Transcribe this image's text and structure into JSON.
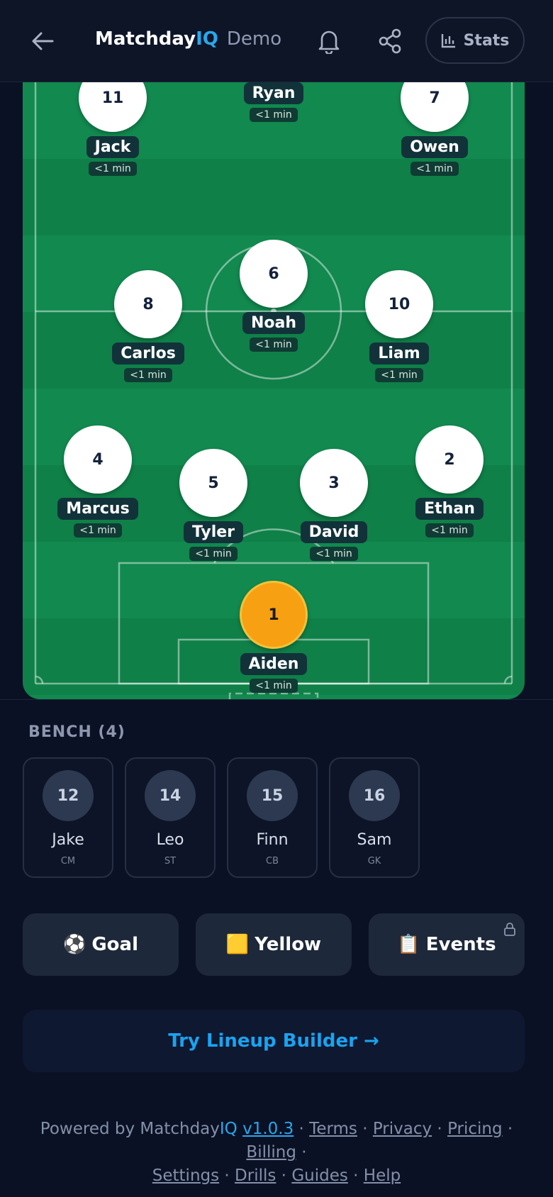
{
  "header": {
    "brand": "Matchday",
    "brand_suffix": "IQ",
    "mode": "Demo",
    "stats_label": "Stats"
  },
  "pitch": {
    "players": [
      {
        "number": "11",
        "name": "Jack",
        "time": "<1 min"
      },
      {
        "number": "",
        "name": "Ryan",
        "time": "<1 min"
      },
      {
        "number": "7",
        "name": "Owen",
        "time": "<1 min"
      },
      {
        "number": "8",
        "name": "Carlos",
        "time": "<1 min"
      },
      {
        "number": "6",
        "name": "Noah",
        "time": "<1 min"
      },
      {
        "number": "10",
        "name": "Liam",
        "time": "<1 min"
      },
      {
        "number": "4",
        "name": "Marcus",
        "time": "<1 min"
      },
      {
        "number": "5",
        "name": "Tyler",
        "time": "<1 min"
      },
      {
        "number": "3",
        "name": "David",
        "time": "<1 min"
      },
      {
        "number": "2",
        "name": "Ethan",
        "time": "<1 min"
      },
      {
        "number": "1",
        "name": "Aiden",
        "time": "<1 min"
      }
    ]
  },
  "bench": {
    "title": "BENCH (4)",
    "players": [
      {
        "number": "12",
        "name": "Jake",
        "position": "CM"
      },
      {
        "number": "14",
        "name": "Leo",
        "position": "ST"
      },
      {
        "number": "15",
        "name": "Finn",
        "position": "CB"
      },
      {
        "number": "16",
        "name": "Sam",
        "position": "GK"
      }
    ]
  },
  "actions": {
    "goal": {
      "icon": "⚽",
      "label": "Goal"
    },
    "yellow": {
      "icon": "🟨",
      "label": "Yellow"
    },
    "events": {
      "icon": "📋",
      "label": "Events"
    }
  },
  "lineup_builder_label": "Try Lineup Builder →",
  "footer": {
    "powered_by": "Powered by Matchday",
    "brand_suffix": "IQ",
    "version": "v1.0.3",
    "links": [
      "Terms",
      "Privacy",
      "Pricing",
      "Billing",
      "Settings",
      "Drills",
      "Guides",
      "Help"
    ]
  },
  "colors": {
    "background": "#0b1125",
    "accent": "#2aa7ea",
    "pitch": "#11894f",
    "goalkeeper": "#f7a012"
  }
}
